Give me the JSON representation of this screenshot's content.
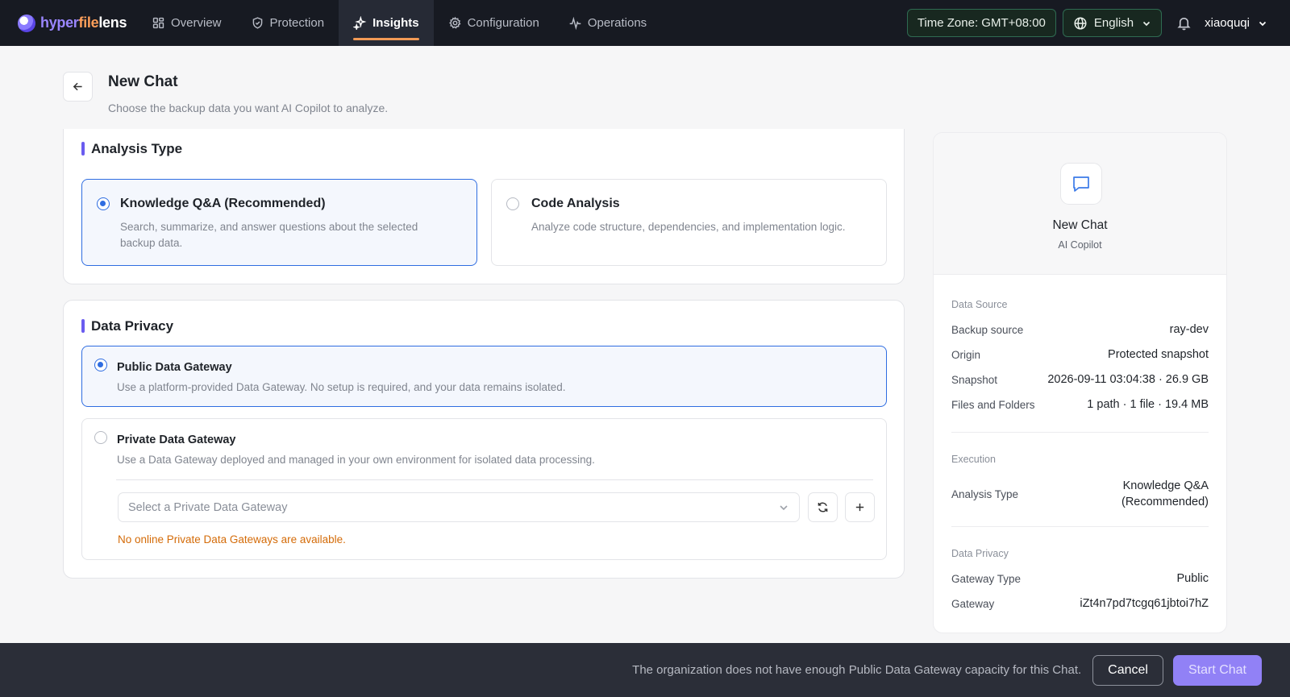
{
  "brand": {
    "part1": "hyper",
    "part2": "file",
    "part3": "lens"
  },
  "nav": {
    "overview": "Overview",
    "protection": "Protection",
    "insights": "Insights",
    "configuration": "Configuration",
    "operations": "Operations",
    "timezone": "Time Zone: GMT+08:00",
    "language": "English",
    "username": "xiaoquqi"
  },
  "header": {
    "title": "New Chat",
    "subtitle": "Choose the backup data you want AI Copilot to analyze."
  },
  "analysis": {
    "section_title": "Analysis Type",
    "options": [
      {
        "title": "Knowledge Q&A (Recommended)",
        "desc": "Search, summarize, and answer questions about the selected backup data.",
        "selected": true
      },
      {
        "title": "Code Analysis",
        "desc": "Analyze code structure, dependencies, and implementation logic.",
        "selected": false
      }
    ]
  },
  "privacy": {
    "section_title": "Data Privacy",
    "public": {
      "title": "Public Data Gateway",
      "desc": "Use a platform-provided Data Gateway. No setup is required, and your data remains isolated.",
      "selected": true
    },
    "private": {
      "title": "Private Data Gateway",
      "desc": "Use a Data Gateway deployed and managed in your own environment for isolated data processing.",
      "select_placeholder": "Select a Private Data Gateway",
      "warning": "No online Private Data Gateways are available.",
      "selected": false
    }
  },
  "summary": {
    "title": "New Chat",
    "subtitle": "AI Copilot",
    "data_source": {
      "label": "Data Source",
      "rows": [
        {
          "key": "Backup source",
          "value": "ray-dev"
        },
        {
          "key": "Origin",
          "value": "Protected snapshot"
        },
        {
          "key": "Snapshot",
          "value": "2026-09-11 03:04:38 · 26.9 GB"
        },
        {
          "key": "Files and Folders",
          "value": "1 path · 1 file · 19.4 MB"
        }
      ]
    },
    "execution": {
      "label": "Execution",
      "rows": [
        {
          "key": "Analysis Type",
          "value_line1": "Knowledge Q&A",
          "value_line2": "(Recommended)"
        }
      ]
    },
    "data_privacy": {
      "label": "Data Privacy",
      "rows": [
        {
          "key": "Gateway Type",
          "value": "Public"
        },
        {
          "key": "Gateway",
          "value": "iZt4n7pd7tcgq61jbtoi7hZ"
        }
      ]
    }
  },
  "footer": {
    "message": "The organization does not have enough Public Data Gateway capacity for this Chat.",
    "cancel_label": "Cancel",
    "start_label": "Start Chat"
  },
  "colors": {
    "accent": "#6a5cf0",
    "selected_border": "#2f6de1",
    "warning": "#d46b08",
    "nav_indicator": "#f29a55",
    "start_button": "#9181f6"
  },
  "icons": [
    "overview-grid-icon",
    "shield-icon",
    "sparkle-icon",
    "gear-icon",
    "pulse-icon",
    "globe-icon",
    "chevron-down-icon",
    "bell-icon",
    "arrow-left-icon",
    "chat-bubble-icon",
    "refresh-icon",
    "plus-icon"
  ]
}
